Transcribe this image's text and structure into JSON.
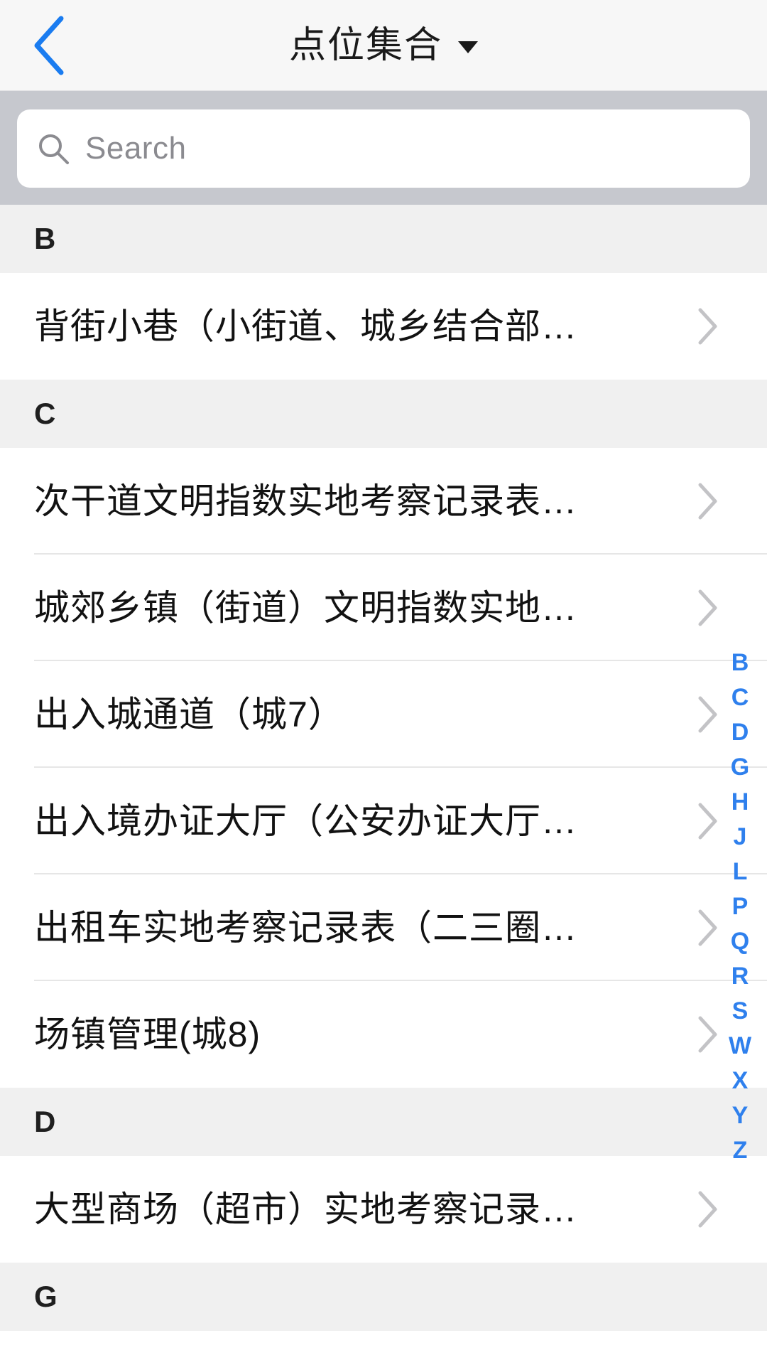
{
  "header": {
    "back_icon": "chevron-left-icon",
    "title": "点位集合",
    "dropdown_icon": "caret-down-icon"
  },
  "search": {
    "icon": "search-icon",
    "placeholder": "Search",
    "value": ""
  },
  "list": {
    "sections": [
      {
        "letter": "B",
        "items": [
          {
            "label": "背街小巷（小街道、城乡结合部…",
            "accessory": "chevron-right-icon"
          }
        ]
      },
      {
        "letter": "C",
        "items": [
          {
            "label": "次干道文明指数实地考察记录表…",
            "accessory": "chevron-right-icon"
          },
          {
            "label": "城郊乡镇（街道）文明指数实地…",
            "accessory": "chevron-right-icon"
          },
          {
            "label": "出入城通道（城7）",
            "accessory": "chevron-right-icon"
          },
          {
            "label": "出入境办证大厅（公安办证大厅…",
            "accessory": "chevron-right-icon"
          },
          {
            "label": "出租车实地考察记录表（二三圈…",
            "accessory": "chevron-right-icon"
          },
          {
            "label": "场镇管理(城8)",
            "accessory": "chevron-right-icon"
          }
        ]
      },
      {
        "letter": "D",
        "items": [
          {
            "label": "大型商场（超市）实地考察记录…",
            "accessory": "chevron-right-icon"
          }
        ]
      },
      {
        "letter": "G",
        "items": []
      }
    ]
  },
  "alpha_index": {
    "letters": [
      "B",
      "C",
      "D",
      "G",
      "H",
      "J",
      "L",
      "P",
      "Q",
      "R",
      "S",
      "W",
      "X",
      "Y",
      "Z"
    ],
    "color": "#2f80ed"
  },
  "colors": {
    "navbar_bg": "#f7f7f7",
    "search_bg": "#c6c8ce",
    "section_bg": "#f0f0f0",
    "row_bg": "#ffffff",
    "accent": "#2f80ed",
    "chevron": "#c3c3c6",
    "text_primary": "#121212",
    "placeholder": "#8b8b90"
  }
}
